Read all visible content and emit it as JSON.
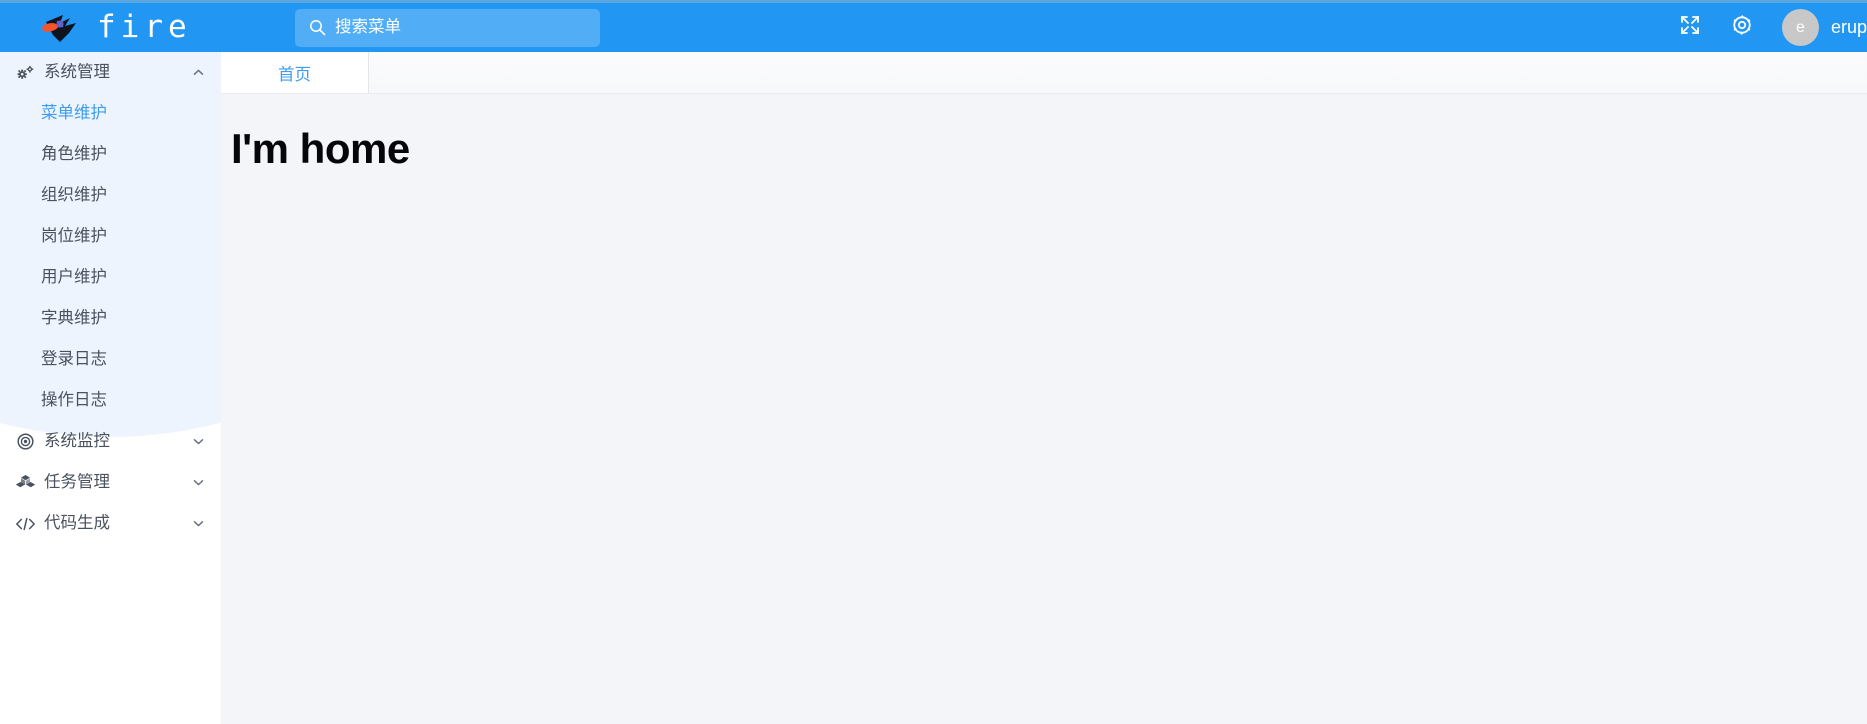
{
  "header": {
    "brand_name": "fire",
    "brand_logo_icon": "fire-bird-logo-icon",
    "search": {
      "placeholder": "搜索菜单",
      "value": "",
      "icon": "search-icon"
    },
    "actions": [
      {
        "icon": "fullscreen-expand-icon",
        "name": "fullscreen-button"
      },
      {
        "icon": "gear-icon",
        "name": "settings-button"
      }
    ],
    "user": {
      "avatar_initial": "e",
      "name": "erup",
      "avatar_color": "#c8c8c8"
    },
    "background_color": "#2196f3"
  },
  "sidebar": {
    "background_color": "#ffffff",
    "decoration_color": "#edf4fd",
    "groups": [
      {
        "label": "系统管理",
        "icon": "gears-icon",
        "expanded": true,
        "chevron": "chevron-up-icon",
        "items": [
          {
            "label": "菜单维护",
            "active": true
          },
          {
            "label": "角色维护",
            "active": false
          },
          {
            "label": "组织维护",
            "active": false
          },
          {
            "label": "岗位维护",
            "active": false
          },
          {
            "label": "用户维护",
            "active": false
          },
          {
            "label": "字典维护",
            "active": false
          },
          {
            "label": "登录日志",
            "active": false
          },
          {
            "label": "操作日志",
            "active": false
          }
        ]
      },
      {
        "label": "系统监控",
        "icon": "target-circle-icon",
        "expanded": false,
        "chevron": "chevron-down-icon",
        "items": []
      },
      {
        "label": "任务管理",
        "icon": "cubes-icon",
        "expanded": false,
        "chevron": "chevron-down-icon",
        "items": []
      },
      {
        "label": "代码生成",
        "icon": "code-brackets-icon",
        "expanded": false,
        "chevron": "chevron-down-icon",
        "items": []
      }
    ]
  },
  "tabbar": {
    "tabs": [
      {
        "label": "首页",
        "active": true
      }
    ],
    "active_color": "#3d9bf0"
  },
  "content": {
    "heading": "I'm home",
    "background_color": "#f4f5f9"
  }
}
